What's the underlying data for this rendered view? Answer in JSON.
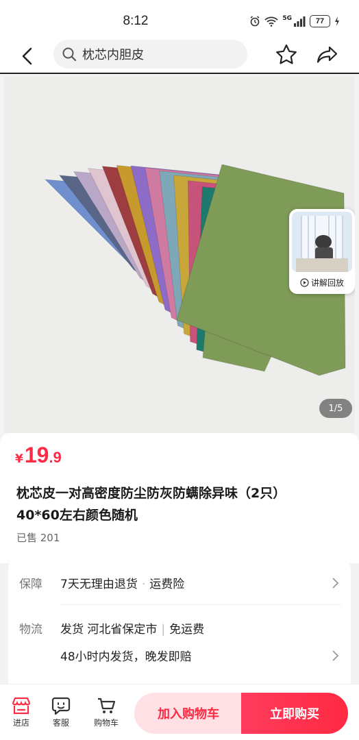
{
  "status_bar": {
    "time": "8:12",
    "network": "5G",
    "battery": "77",
    "icons": [
      "alarm-icon",
      "wifi-icon",
      "signal-icon",
      "battery-icon",
      "charging-icon"
    ]
  },
  "nav": {
    "search_text": "枕芯内胆皮",
    "icons": [
      "back-arrow-icon",
      "search-icon",
      "star-icon",
      "share-icon"
    ]
  },
  "gallery": {
    "video_label": "讲解回放",
    "counter": "1/5",
    "pillow_colors": [
      "#6f8fcf",
      "#5a6688",
      "#b9a7c8",
      "#e0c4cf",
      "#9d3d3f",
      "#c69a2c",
      "#8d6cc8",
      "#cf7aa0",
      "#7ea7b7",
      "#c8a63a",
      "#c8537a",
      "#1f7a6e",
      "#7f9b58"
    ]
  },
  "product": {
    "price_symbol": "¥",
    "price_int": "19",
    "price_dec": ".9",
    "title_line1": "枕芯皮一对高密度防尘防灰防螨除异味（2只）",
    "title_line2": "40*60左右颜色随机",
    "sold": "已售 201"
  },
  "service": {
    "guarantee_label": "保障",
    "guarantee_item1": "7天无理由退货",
    "guarantee_sep": "·",
    "guarantee_item2": "运费险",
    "shipping_label": "物流",
    "shipping_from": "发货 河北省保定市",
    "shipping_sep": "|",
    "shipping_fee": "免运费",
    "shipping_note": "48小时内发货，晚发即赔"
  },
  "bottom_bar": {
    "tab_store": "进店",
    "tab_service": "客服",
    "tab_cart": "购物车",
    "add_to_cart": "加入购物车",
    "buy_now": "立即购买",
    "accent_color": "#ff2a43"
  }
}
